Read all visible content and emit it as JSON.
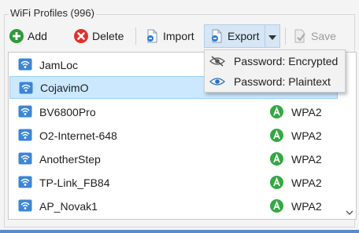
{
  "group": {
    "title": "WiFi Profiles (996)"
  },
  "toolbar": {
    "add_label": "Add",
    "delete_label": "Delete",
    "import_label": "Import",
    "export_label": "Export",
    "save_label": "Save"
  },
  "export_menu": {
    "items": [
      {
        "label": "Password: Encrypted",
        "icon": "eye-crossed-icon"
      },
      {
        "label": "Password: Plaintext",
        "icon": "eye-icon"
      }
    ]
  },
  "profiles": {
    "rows": [
      {
        "name": "JamLoc",
        "security": ""
      },
      {
        "name": "CojavimO",
        "security": ""
      },
      {
        "name": "BV6800Pro",
        "security": "WPA2"
      },
      {
        "name": "O2-Internet-648",
        "security": "WPA2"
      },
      {
        "name": "AnotherStep",
        "security": "WPA2"
      },
      {
        "name": "TP-Link_FB84",
        "security": "WPA2"
      },
      {
        "name": "AP_Novak1",
        "security": "WPA2"
      }
    ],
    "selected_index": 1
  },
  "colors": {
    "accent": "#0078d7",
    "add_green": "#2e9a3c",
    "delete_red": "#e0312b",
    "auth_green": "#35a745",
    "selection": "#cce8ff"
  }
}
